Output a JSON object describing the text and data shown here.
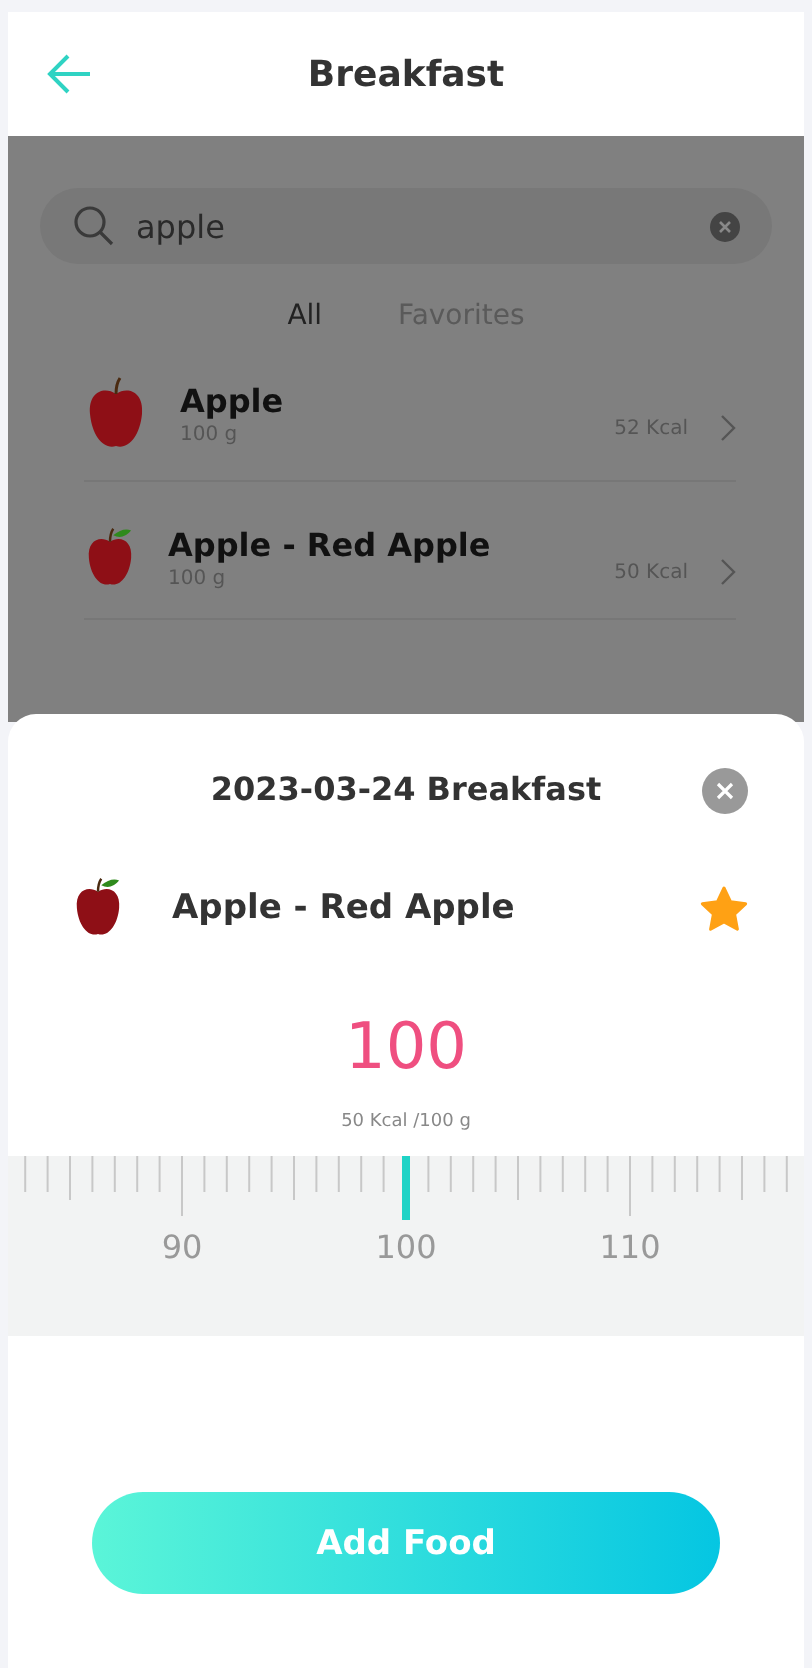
{
  "header": {
    "title": "Breakfast"
  },
  "search": {
    "value": "apple"
  },
  "tabs": [
    {
      "label": "All",
      "selected": true
    },
    {
      "label": "Favorites",
      "selected": false
    }
  ],
  "foods": [
    {
      "name": "Apple",
      "amount": "100 g",
      "kcal": "52 Kcal",
      "kind": "plain"
    },
    {
      "name": "Apple - Red Apple",
      "amount": "100 g",
      "kcal": "50 Kcal",
      "kind": "leaf"
    }
  ],
  "sheet": {
    "title": "2023-03-24 Breakfast",
    "food": {
      "name": "Apple - Red Apple",
      "kind": "leaf",
      "favorite": true
    },
    "amount": "100",
    "per": "50 Kcal /100 g",
    "ruler_labels": [
      "90",
      "100",
      "110"
    ],
    "button": "Add Food"
  }
}
